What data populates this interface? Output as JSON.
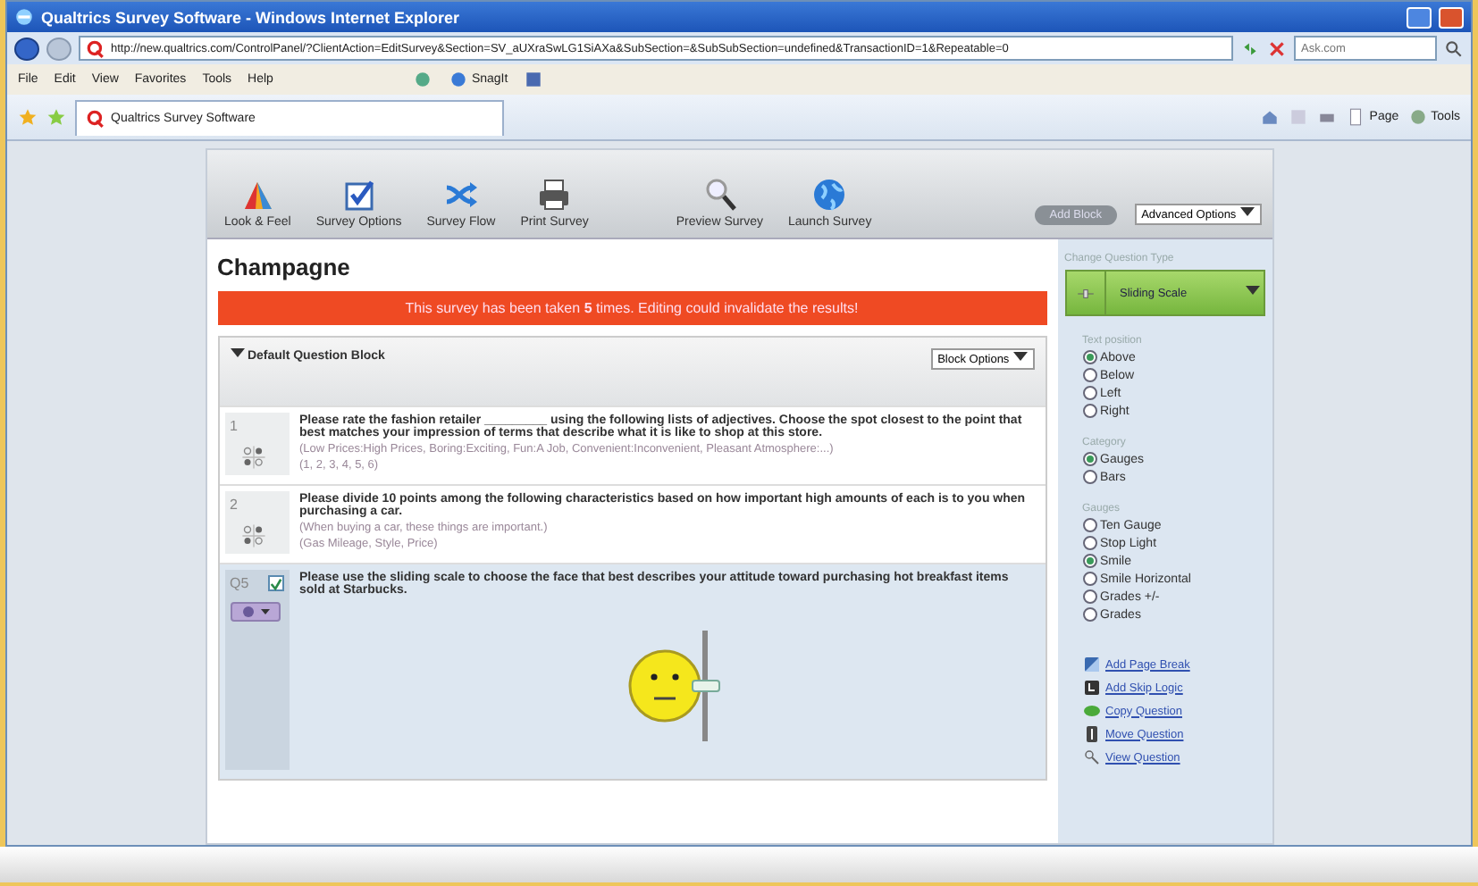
{
  "window": {
    "title": "Qualtrics Survey Software - Windows Internet Explorer"
  },
  "address_bar": {
    "url": "http://new.qualtrics.com/ControlPanel/?ClientAction=EditSurvey&Section=SV_aUXraSwLG1SiAXa&SubSection=&SubSubSection=undefined&TransactionID=1&Repeatable=0",
    "search_placeholder": "Ask.com"
  },
  "menu_bar": [
    "File",
    "Edit",
    "View",
    "Favorites",
    "Tools",
    "Help"
  ],
  "links_bar": {
    "snagit": "SnagIt"
  },
  "tabs": [
    {
      "label": "Qualtrics Survey Software",
      "selected": true
    }
  ],
  "command_bar": [
    "Page",
    "Tools"
  ],
  "toolbar": {
    "items": [
      "Look & Feel",
      "Survey Options",
      "Survey Flow",
      "Print Survey",
      "Preview Survey",
      "Launch Survey"
    ],
    "add_block": "Add Block",
    "advanced_options": "Advanced Options"
  },
  "survey_title": "Champagne",
  "warning": "This survey has been taken **5** times. Editing could invalidate the results!",
  "block": {
    "title": "Default Question Block",
    "options_button": "Block Options",
    "questions": [
      {
        "number": "1",
        "selected": false,
        "text": "Please rate the fashion retailer _________ using the following lists of adjectives.  Choose the spot closest to the point that best matches your impression of terms that describe what it is like to shop at this store.",
        "note": "(Low Prices:High Prices, Boring:Exciting, Fun:A Job, Convenient:Inconvenient, Pleasant Atmosphere:...)",
        "choices": "(1, 2, 3, 4, 5, 6)"
      },
      {
        "number": "2",
        "selected": false,
        "text": "Please divide 10 points among the following characteristics based on how important high amounts of each is to you when purchasing a car.",
        "note": "(When buying a car, these things are important.)",
        "choices": "(Gas Mileage, Style, Price)"
      },
      {
        "number": "Q5",
        "selected": true,
        "checked": true,
        "text": "Please use the sliding scale to choose the face that best describes your attitude toward purchasing hot breakfast items sold at Starbucks.",
        "level": 0.5
      }
    ]
  },
  "side_panel": {
    "question_type_label": "Change Question Type",
    "question_type": "Sliding Scale",
    "groups": [
      {
        "label": "Text position",
        "options": [
          {
            "label": "Above",
            "selected": true
          },
          {
            "label": "Below",
            "selected": false
          },
          {
            "label": "Left",
            "selected": false
          },
          {
            "label": "Right",
            "selected": false
          }
        ]
      },
      {
        "label": "Category",
        "options": [
          {
            "label": "Gauges",
            "selected": true
          },
          {
            "label": "Bars",
            "selected": false
          }
        ]
      },
      {
        "label": "Gauges",
        "options": [
          {
            "label": "Ten Gauge",
            "selected": false
          },
          {
            "label": "Stop Light",
            "selected": false
          },
          {
            "label": "Smile",
            "selected": true
          },
          {
            "label": "Smile Horizontal",
            "selected": false
          },
          {
            "label": "Grades +/-",
            "selected": false
          },
          {
            "label": "Grades",
            "selected": false
          }
        ]
      }
    ],
    "actions": [
      "Add Page Break",
      "Add Skip Logic",
      "Copy Question",
      "Move Question",
      "View Question"
    ]
  }
}
